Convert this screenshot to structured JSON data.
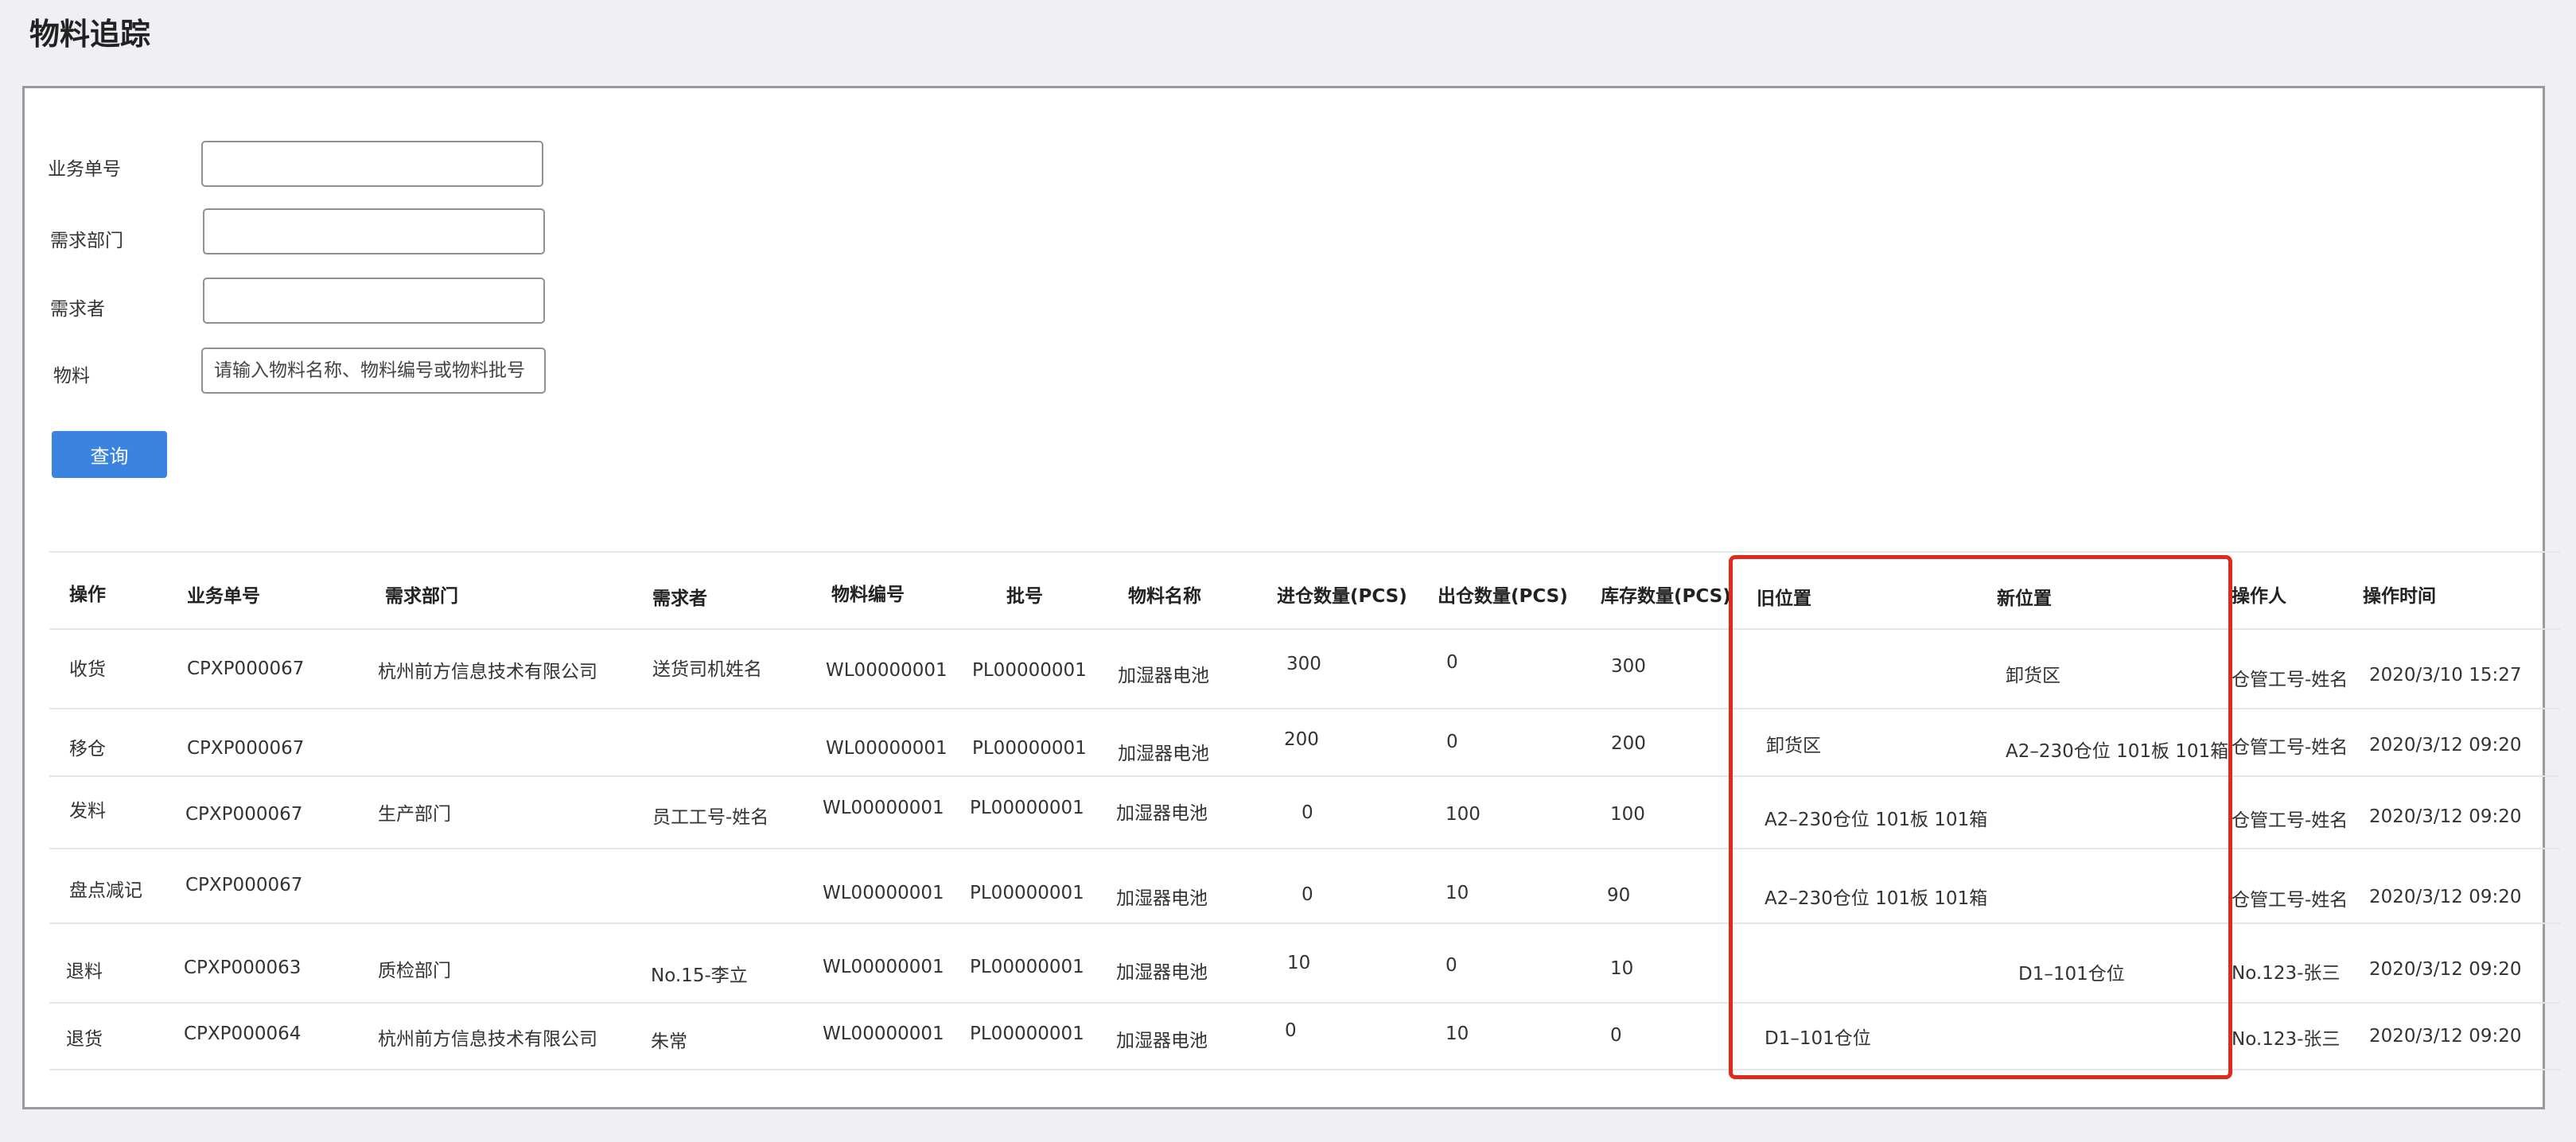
{
  "page": {
    "title": "物料追踪"
  },
  "form": {
    "fields": [
      {
        "label": "业务单号",
        "value": "",
        "placeholder": ""
      },
      {
        "label": "需求部门",
        "value": "",
        "placeholder": ""
      },
      {
        "label": "需求者",
        "value": "",
        "placeholder": ""
      },
      {
        "label": "物料",
        "value": "",
        "placeholder": "请输入物料名称、物料编号或物料批号"
      }
    ],
    "query_button": "查询"
  },
  "table": {
    "columns": [
      "操作",
      "业务单号",
      "需求部门",
      "需求者",
      "物料编号",
      "批号",
      "物料名称",
      "进仓数量(PCS)",
      "出仓数量(PCS)",
      "库存数量(PCS)",
      "旧位置",
      "新位置",
      "操作人",
      "操作时间"
    ],
    "rows": [
      [
        "收货",
        "CPXP000067",
        "杭州前方信息技术有限公司",
        "送货司机姓名",
        "WL00000001",
        "PL00000001",
        "加湿器电池",
        "300",
        "0",
        "300",
        "",
        "卸货区",
        "仓管工号-姓名",
        "2020/3/10 15:27"
      ],
      [
        "移仓",
        "CPXP000067",
        "",
        "",
        "WL00000001",
        "PL00000001",
        "加湿器电池",
        "200",
        "0",
        "200",
        "卸货区",
        "A2–230仓位 101板 101箱",
        "仓管工号-姓名",
        "2020/3/12 09:20"
      ],
      [
        "发料",
        "CPXP000067",
        "生产部门",
        "员工工号-姓名",
        "WL00000001",
        "PL00000001",
        "加湿器电池",
        "0",
        "100",
        "100",
        "A2–230仓位 101板 101箱",
        "",
        "仓管工号-姓名",
        "2020/3/12 09:20"
      ],
      [
        "盘点减记",
        "CPXP000067",
        "",
        "",
        "WL00000001",
        "PL00000001",
        "加湿器电池",
        "0",
        "10",
        "90",
        "A2–230仓位 101板 101箱",
        "",
        "仓管工号-姓名",
        "2020/3/12 09:20"
      ],
      [
        "退料",
        "CPXP000063",
        "质检部门",
        "No.15-李立",
        "WL00000001",
        "PL00000001",
        "加湿器电池",
        "10",
        "0",
        "10",
        "",
        "D1–101仓位",
        "No.123-张三",
        "2020/3/12 09:20"
      ],
      [
        "退货",
        "CPXP000064",
        "杭州前方信息技术有限公司",
        "朱常",
        "WL00000001",
        "PL00000001",
        "加湿器电池",
        "0",
        "10",
        "0",
        "D1–101仓位",
        "",
        "No.123-张三",
        "2020/3/12 09:20"
      ]
    ]
  },
  "colors": {
    "primary": "#3a83e0",
    "highlight": "#e02a1e",
    "background": "#efeff4"
  }
}
